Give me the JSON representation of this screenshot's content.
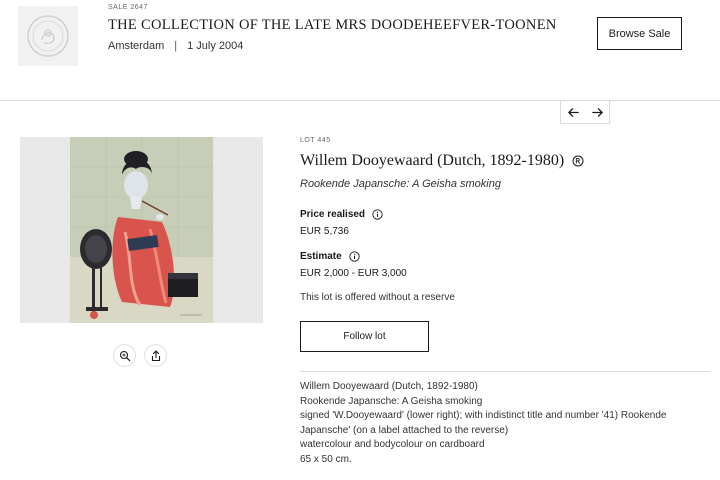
{
  "sale": {
    "number": "SALE 2647",
    "title": "THE COLLECTION OF THE LATE MRS DOODEHEEFVER-TOONEN",
    "location": "Amsterdam",
    "separator": "|",
    "date": "1 July 2004",
    "browse_label": "Browse Sale",
    "thumbnail_icon": "seal-emblem-icon"
  },
  "navigation": {
    "prev_icon": "arrow-left-icon",
    "next_icon": "arrow-right-icon"
  },
  "image_tools": {
    "zoom_icon": "zoom-in-icon",
    "share_icon": "share-icon"
  },
  "lot": {
    "number": "LOT 445",
    "artist": "Willem Dooyewaard (Dutch, 1892-1980)",
    "artist_badge_icon": "artist-registered-icon",
    "title": "Rookende Japansche: A Geisha smoking",
    "price_label": "Price realised",
    "price_value": "EUR 5,736",
    "estimate_label": "Estimate",
    "estimate_value": "EUR 2,000 - EUR 3,000",
    "reserve_note": "This lot is offered without a reserve",
    "follow_label": "Follow lot",
    "description_lines": [
      "Willem Dooyewaard (Dutch, 1892-1980)",
      "Rookende Japansche: A Geisha smoking",
      "signed 'W.Dooyewaard' (lower right); with indistinct title and number '41) Rookende Japansche' (on a label attached to the reverse)",
      "watercolour and bodycolour on cardboard",
      "65 x 50 cm."
    ]
  },
  "colors": {
    "text": "#1a1a1a",
    "border": "#d9d9d9",
    "image_bg": "#e8e8e8"
  }
}
